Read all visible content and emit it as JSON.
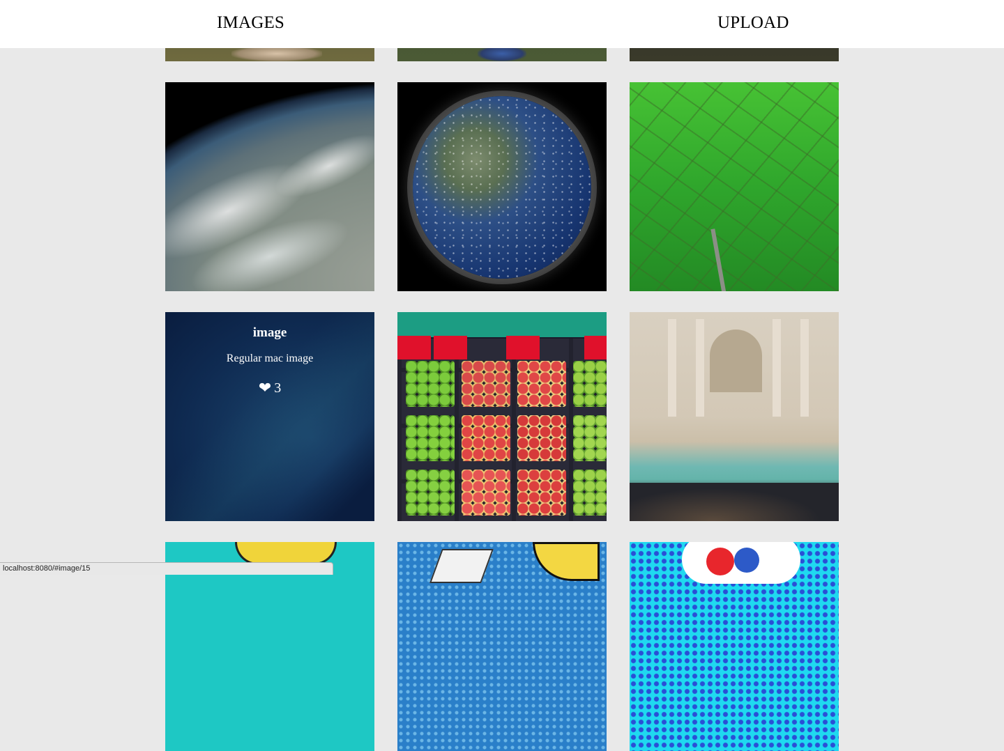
{
  "nav": {
    "images_label": "IMAGES",
    "upload_label": "UPLOAD"
  },
  "gallery": {
    "hovered_image": {
      "title": "image",
      "description": "Regular mac image",
      "likes": "3"
    },
    "icons": {
      "like": "heart-icon"
    }
  },
  "status_bar": {
    "url": "localhost:8080/#image/15"
  },
  "colors": {
    "page_background": "#e9e9e9",
    "header_background": "#ffffff"
  }
}
